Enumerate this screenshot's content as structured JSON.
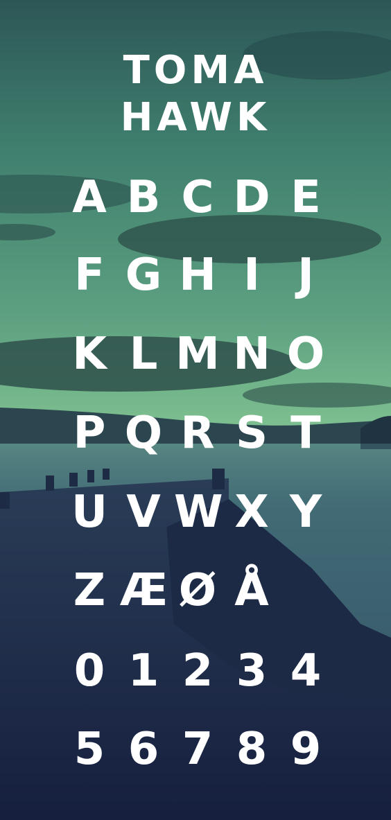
{
  "poster": {
    "title_line1": "TOMA",
    "title_line2": "HAWK",
    "rows": [
      [
        "A",
        "B",
        "C",
        "D",
        "E"
      ],
      [
        "F",
        "G",
        "H",
        "I",
        "J"
      ],
      [
        "K",
        "L",
        "M",
        "N",
        "O"
      ],
      [
        "P",
        "Q",
        "R",
        "S",
        "T"
      ],
      [
        "U",
        "V",
        "W",
        "X",
        "Y"
      ],
      [
        "Z",
        "Æ",
        "Ø",
        "Å"
      ],
      [
        "0",
        "1",
        "2",
        "3",
        "4"
      ],
      [
        "5",
        "6",
        "7",
        "8",
        "9"
      ]
    ]
  },
  "colors": {
    "sky_top": "#2e5a58",
    "sky_mid": "#6fae8c",
    "water": "#3f6a74",
    "dark": "#1b2545",
    "glyph": "#ffffff"
  }
}
